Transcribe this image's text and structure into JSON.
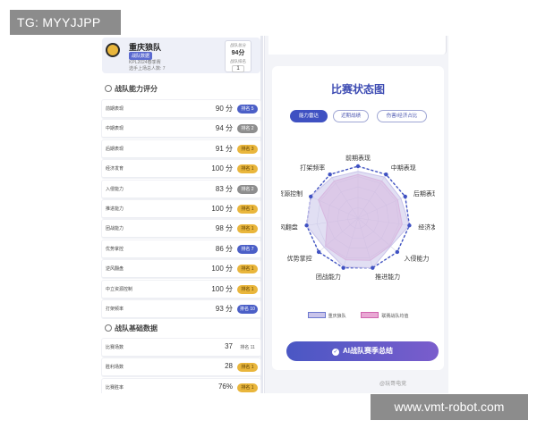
{
  "watermarks": {
    "top_left": "TG: MYYJJPP",
    "bottom_right": "www.vmt-robot.com"
  },
  "team": {
    "name": "重庆狼队",
    "tag": "战队数据",
    "season": "KPL2024春季赛",
    "last_match": "选手上场总人数: 7",
    "score_label": "战队总分",
    "score_value": "94分",
    "rank_label": "战队排名",
    "rank_value": "1"
  },
  "ability": {
    "section_title": "战队能力评分",
    "rows": [
      {
        "name": "前期表现",
        "value": "90 分",
        "rank": "排名 5",
        "color": "blue"
      },
      {
        "name": "中期表现",
        "value": "94 分",
        "rank": "排名 2",
        "color": "gray"
      },
      {
        "name": "后期表现",
        "value": "91 分",
        "rank": "排名 3",
        "color": "gold"
      },
      {
        "name": "经济发育",
        "value": "100 分",
        "rank": "排名 1",
        "color": "gold"
      },
      {
        "name": "入侵能力",
        "value": "83 分",
        "rank": "排名 2",
        "color": "gray"
      },
      {
        "name": "推进能力",
        "value": "100 分",
        "rank": "排名 1",
        "color": "gold"
      },
      {
        "name": "团战能力",
        "value": "98 分",
        "rank": "排名 1",
        "color": "gold"
      },
      {
        "name": "优势掌控",
        "value": "86 分",
        "rank": "排名 7",
        "color": "blue"
      },
      {
        "name": "逆风翻盘",
        "value": "100 分",
        "rank": "排名 1",
        "color": "gold"
      },
      {
        "name": "中立资源控制",
        "value": "100 分",
        "rank": "排名 1",
        "color": "gold"
      },
      {
        "name": "打架频率",
        "value": "93 分",
        "rank": "排名 10",
        "color": "blue"
      }
    ]
  },
  "basic": {
    "section_title": "战队基础数据",
    "rows": [
      {
        "name": "比赛场数",
        "value": "37",
        "rank": "排名 11",
        "color": "plain"
      },
      {
        "name": "胜利场数",
        "value": "28",
        "rank": "排名 1",
        "color": "gold"
      },
      {
        "name": "比赛胜率",
        "value": "76%",
        "rank": "排名 1",
        "color": "gold"
      }
    ]
  },
  "status": {
    "title": "比赛状态图",
    "tabs": [
      "能力雷达",
      "近期战绩",
      "伤害/经济占比"
    ],
    "active_tab": 0,
    "ai_button": "AI战队赛季总结",
    "credit": "@玩哥电竞"
  },
  "radar": {
    "axes": [
      "前期表现",
      "中期表现",
      "后期表现",
      "经济发育",
      "入侵能力",
      "推进能力",
      "团战能力",
      "优势掌控",
      "逆风翻盘",
      "中立资源控制",
      "打架频率"
    ],
    "series": [
      {
        "name": "重庆狼队",
        "values": [
          90,
          94,
          91,
          100,
          83,
          100,
          98,
          86,
          100,
          100,
          93
        ],
        "color": "#c9c4ea"
      },
      {
        "name": "联赛战队均值",
        "values": [
          84,
          85,
          84,
          86,
          82,
          85,
          84,
          83,
          60,
          84,
          85
        ],
        "color": "#e9a8d4"
      }
    ],
    "max": 100
  }
}
